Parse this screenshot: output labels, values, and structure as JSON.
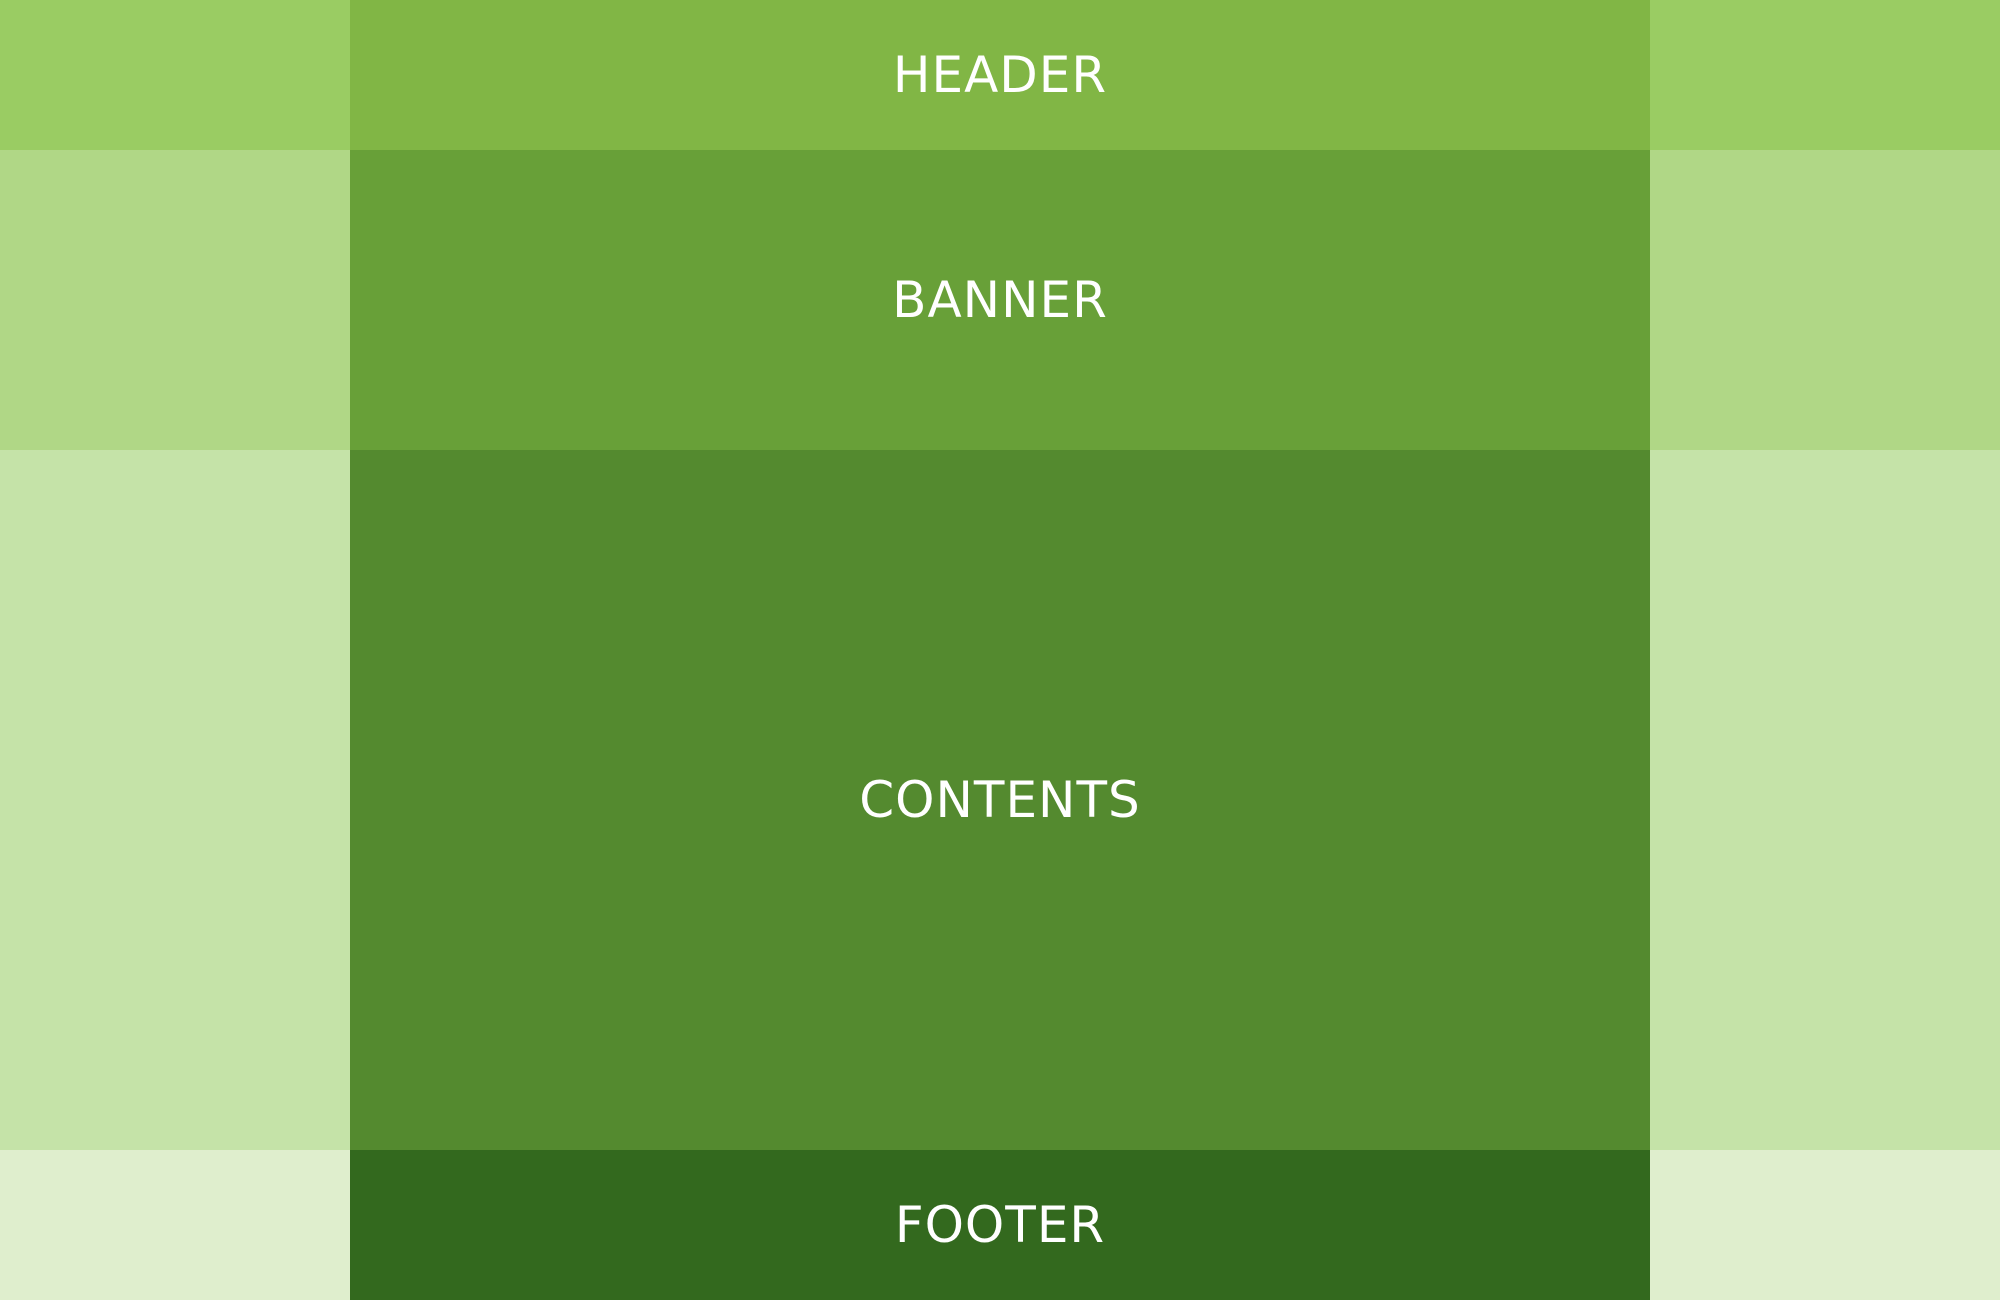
{
  "sections": [
    {
      "id": "header",
      "label": "HEADER",
      "center_color": "#81B645",
      "side_color": "#9ACC63"
    },
    {
      "id": "banner",
      "label": "BANNER",
      "center_color": "#68A038",
      "side_color": "#B0D786"
    },
    {
      "id": "contents",
      "label": "CONTENTS",
      "center_color": "#548A2F",
      "side_color": "#C5E3A8"
    },
    {
      "id": "footer",
      "label": "FOOTER",
      "center_color": "#33691E",
      "side_color": "#DFEECD"
    }
  ]
}
